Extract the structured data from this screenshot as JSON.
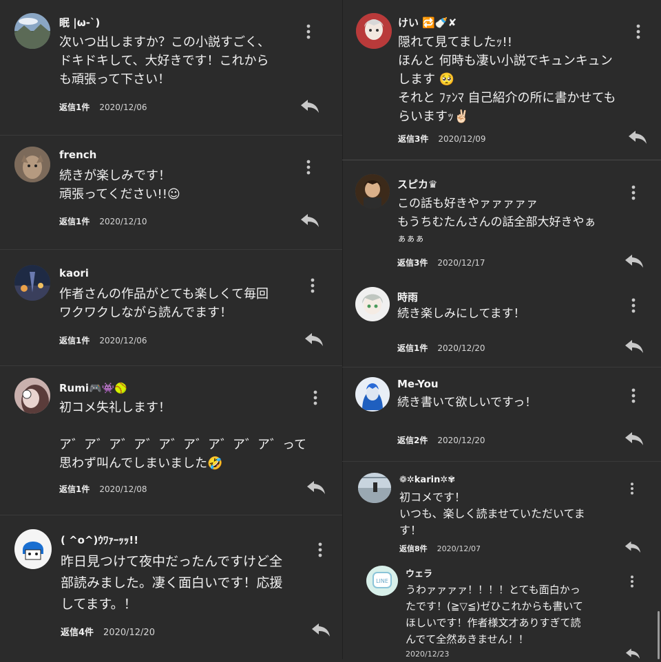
{
  "comments_left": [
    {
      "name": "眠 |ω-`)",
      "lines": [
        "次いつ出しますか？この小説すごく、",
        "ドキドキして、大好きです！これから",
        "も頑張って下さい！"
      ],
      "replies": "返信1件",
      "date": "2020/12/06"
    },
    {
      "name": "french",
      "lines": [
        "続きが楽しみです！",
        "頑張ってください!!☺"
      ],
      "replies": "返信1件",
      "date": "2020/12/10"
    },
    {
      "name": "kaori",
      "lines": [
        "作者さんの作品がとても楽しくて毎回",
        "ワクワクしながら読んでます！"
      ],
      "replies": "返信1件",
      "date": "2020/12/06"
    },
    {
      "name": "Rumi🎮👾🥎",
      "lines": [
        "初コメ失礼します！",
        "",
        "ア゛ア゛ア゛ア゛ア゛ア゛ア゛ア゛ア゛って",
        "思わず叫んでしまいました🤣"
      ],
      "replies": "返信1件",
      "date": "2020/12/08"
    },
    {
      "name": "( ^o^)ｳﾜｧｰｯｯ!!",
      "lines": [
        "昨日見つけて夜中だったんですけど全",
        "部読みました。凄く面白いです！応援",
        "してます。！"
      ],
      "replies": "返信4件",
      "date": "2020/12/20"
    }
  ],
  "comments_right": [
    {
      "name": "けい 🔁🍼✘",
      "lines": [
        "隠れて見てましたｯ!!",
        "ほんと 何時も凄い小説でキュンキュン",
        "します 🥺",
        "それと ﾌｧﾝﾏ 自己紹介の所に書かせても",
        "らいますｯ✌🏻"
      ],
      "replies": "返信3件",
      "date": "2020/12/09"
    },
    {
      "name": "スピカ♛",
      "lines": [
        "この話も好きやァァァァァ",
        "もうちむたんさんの話全部大好きやぁ",
        "ぁぁぁ"
      ],
      "replies": "返信3件",
      "date": "2020/12/17"
    },
    {
      "name": "時雨",
      "lines": [
        "続き楽しみにしてます！"
      ],
      "replies": "返信1件",
      "date": "2020/12/20"
    },
    {
      "name": "Me-You",
      "lines": [
        "続き書いて欲しいですっ！"
      ],
      "replies": "返信2件",
      "date": "2020/12/20"
    },
    {
      "name": "❁✲karin✲✾",
      "lines": [
        "初コメです！",
        "いつも、楽しく読ませていただいてま",
        "す！"
      ],
      "replies": "返信8件",
      "date": "2020/12/07"
    },
    {
      "name": "ウェラ",
      "lines": [
        "うわァァァァ！！！！とても面白かっ",
        "たです！(≧▽≦)ゼひこれからも書いて",
        "ほしいです！作者様文才ありすぎて読",
        "んでて全然あきません！！"
      ],
      "replies": "",
      "date": "2020/12/23"
    }
  ],
  "icons": {
    "more": "more-vertical-icon",
    "reply": "reply-arrow-icon"
  },
  "colors": {
    "background": "#2b2b2b",
    "text": "#f1f1f1",
    "icon": "#c8c8c8"
  }
}
